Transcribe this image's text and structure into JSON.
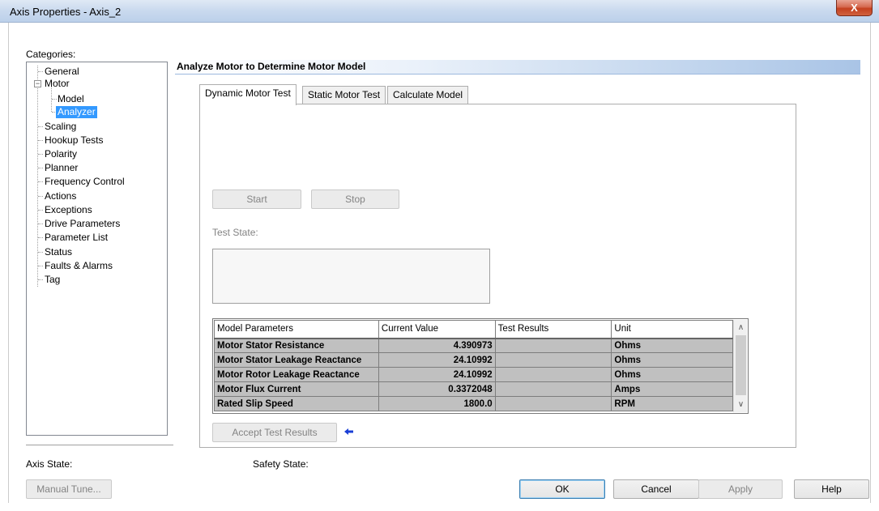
{
  "window": {
    "title": "Axis Properties - Axis_2",
    "close_glyph": "X"
  },
  "categories_label": "Categories:",
  "tree": {
    "items": [
      {
        "label": "General"
      },
      {
        "label": "Motor",
        "expander": "−"
      },
      {
        "label": "Model"
      },
      {
        "label": "Analyzer"
      },
      {
        "label": "Scaling"
      },
      {
        "label": "Hookup Tests"
      },
      {
        "label": "Polarity"
      },
      {
        "label": "Planner"
      },
      {
        "label": "Frequency Control"
      },
      {
        "label": "Actions"
      },
      {
        "label": "Exceptions"
      },
      {
        "label": "Drive Parameters"
      },
      {
        "label": "Parameter List"
      },
      {
        "label": "Status"
      },
      {
        "label": "Faults & Alarms"
      },
      {
        "label": "Tag"
      }
    ],
    "selected": "Analyzer"
  },
  "section_title": "Analyze Motor to Determine Motor Model",
  "tabs": [
    {
      "label": "Dynamic Motor Test",
      "active": true
    },
    {
      "label": "Static Motor Test",
      "active": false
    },
    {
      "label": "Calculate Model",
      "active": false
    }
  ],
  "panel": {
    "start_label": "Start",
    "stop_label": "Stop",
    "test_state_label": "Test State:",
    "accept_label": "Accept Test Results",
    "arrow_glyph": "◆"
  },
  "grid": {
    "columns": [
      "Model Parameters",
      "Current Value",
      "Test Results",
      "Unit"
    ],
    "rows": [
      {
        "param": "Motor Stator Resistance",
        "current": "4.390973",
        "test": "",
        "unit": "Ohms"
      },
      {
        "param": "Motor Stator Leakage Reactance",
        "current": "24.10992",
        "test": "",
        "unit": "Ohms"
      },
      {
        "param": "Motor Rotor Leakage Reactance",
        "current": "24.10992",
        "test": "",
        "unit": "Ohms"
      },
      {
        "param": "Motor Flux Current",
        "current": "0.3372048",
        "test": "",
        "unit": "Amps"
      },
      {
        "param": "Rated Slip Speed",
        "current": "1800.0",
        "test": "",
        "unit": "RPM"
      }
    ],
    "scroll_up": "∧",
    "scroll_down": "∨"
  },
  "footer": {
    "axis_state_label": "Axis State:",
    "safety_state_label": "Safety State:",
    "manual_tune_label": "Manual Tune...",
    "ok_label": "OK",
    "cancel_label": "Cancel",
    "apply_label": "Apply",
    "help_label": "Help"
  }
}
